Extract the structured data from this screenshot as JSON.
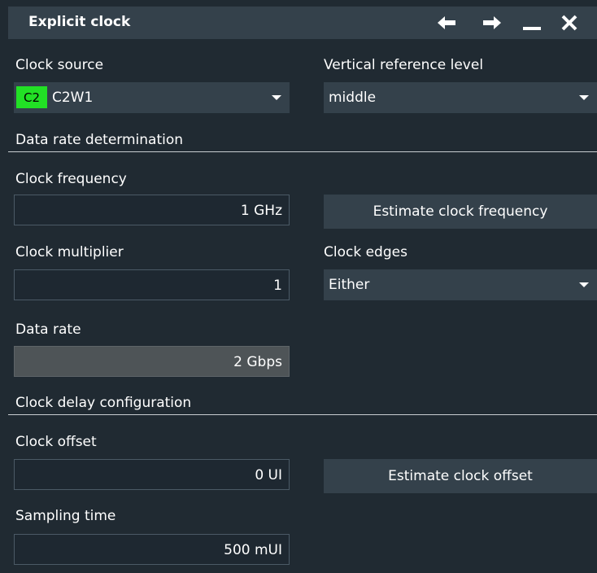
{
  "window": {
    "title": "Explicit clock",
    "controls": [
      "arrow-left-icon",
      "arrow-right-icon",
      "minimize-icon",
      "close-icon"
    ]
  },
  "clock_source": {
    "label": "Clock source",
    "badge": "C2",
    "badge_color": "#22e025",
    "value": "C2W1"
  },
  "vertical_reference": {
    "label": "Vertical reference level",
    "value": "middle"
  },
  "data_rate_section": {
    "title": "Data rate determination"
  },
  "clock_frequency": {
    "label": "Clock frequency",
    "value": "1 GHz",
    "estimate_button": "Estimate clock frequency"
  },
  "clock_multiplier": {
    "label": "Clock multiplier",
    "value": "1"
  },
  "clock_edges": {
    "label": "Clock edges",
    "value": "Either"
  },
  "data_rate": {
    "label": "Data rate",
    "value": "2 Gbps"
  },
  "delay_section": {
    "title": "Clock delay configuration"
  },
  "clock_offset": {
    "label": "Clock offset",
    "value": "0 UI",
    "estimate_button": "Estimate clock offset"
  },
  "sampling_time": {
    "label": "Sampling time",
    "value": "500 mUI"
  },
  "colors": {
    "background": "#202a32",
    "titlebar": "#34414b",
    "accent_green": "#22e025"
  }
}
